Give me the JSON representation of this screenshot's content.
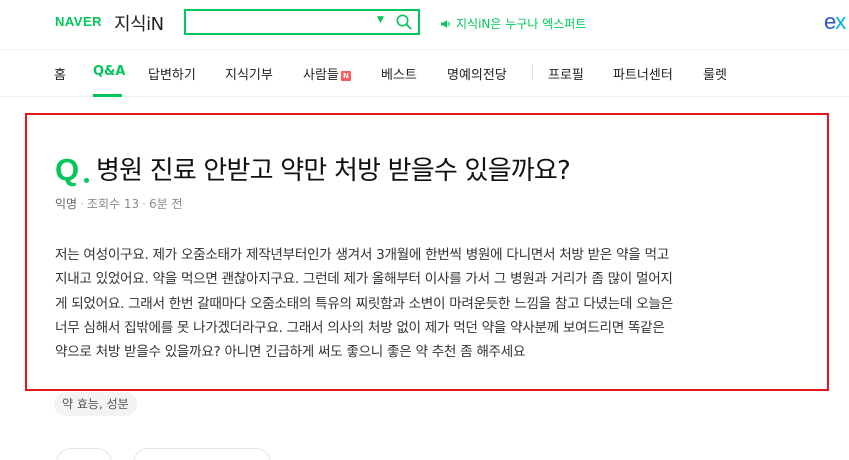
{
  "header": {
    "naver_logo": "NAVER",
    "service_logo": "지식iN",
    "search": {
      "value": "",
      "placeholder": ""
    },
    "notice": "지식iN은 누구나 엑스퍼트",
    "expert_logo_e": "e",
    "expert_logo_x": "x"
  },
  "nav": {
    "items": [
      {
        "label": "홈"
      },
      {
        "label": "Q&A"
      },
      {
        "label": "답변하기"
      },
      {
        "label": "지식기부"
      },
      {
        "label": "사람들",
        "badge": "N"
      },
      {
        "label": "베스트"
      },
      {
        "label": "명예의전당"
      },
      {
        "label": "프로필"
      },
      {
        "label": "파트너센터"
      },
      {
        "label": "룰렛"
      }
    ],
    "active": "Q&A"
  },
  "question": {
    "q_mark": "Q",
    "title": "병원 진료 안받고 약만 처방 받을수 있을까요?",
    "author": "익명",
    "views": "조회수 13",
    "time": "6분 전",
    "body_lines": [
      "저는 여성이구요. 제가 오줌소태가 제작년부터인가 생겨서 3개월에 한번씩 병원에 다니면서 처방 받은 약을 먹고",
      "지내고 있었어요. 약을 먹으면 괜찮아지구요. 그런데 제가 올해부터 이사를 가서 그 병원과 거리가 좀 많이 멀어지",
      "게 되었어요. 그래서 한번 갈때마다 오줌소태의 특유의 찌릿함과 소변이 마려운듯한 느낌을 참고 다녔는데 오늘은",
      "너무 심해서 집밖에를 못 나가겠더라구요. 그래서 의사의 처방 없이 제가 먹던 약을 약사분께 보여드리면 똑같은",
      "약으로 처방 받을수 있을까요? 아니면 긴급하게 써도 좋으니 좋은 약 추천 좀 해주세요"
    ],
    "tag": "약 효능, 성분"
  },
  "colors": {
    "brand_green": "#03c75a",
    "highlight_red": "#e8141b",
    "badge_red": "#ff5a5a"
  },
  "icons": {
    "search": "search-icon",
    "dropdown": "caret-down-icon",
    "notice": "speaker-icon"
  }
}
